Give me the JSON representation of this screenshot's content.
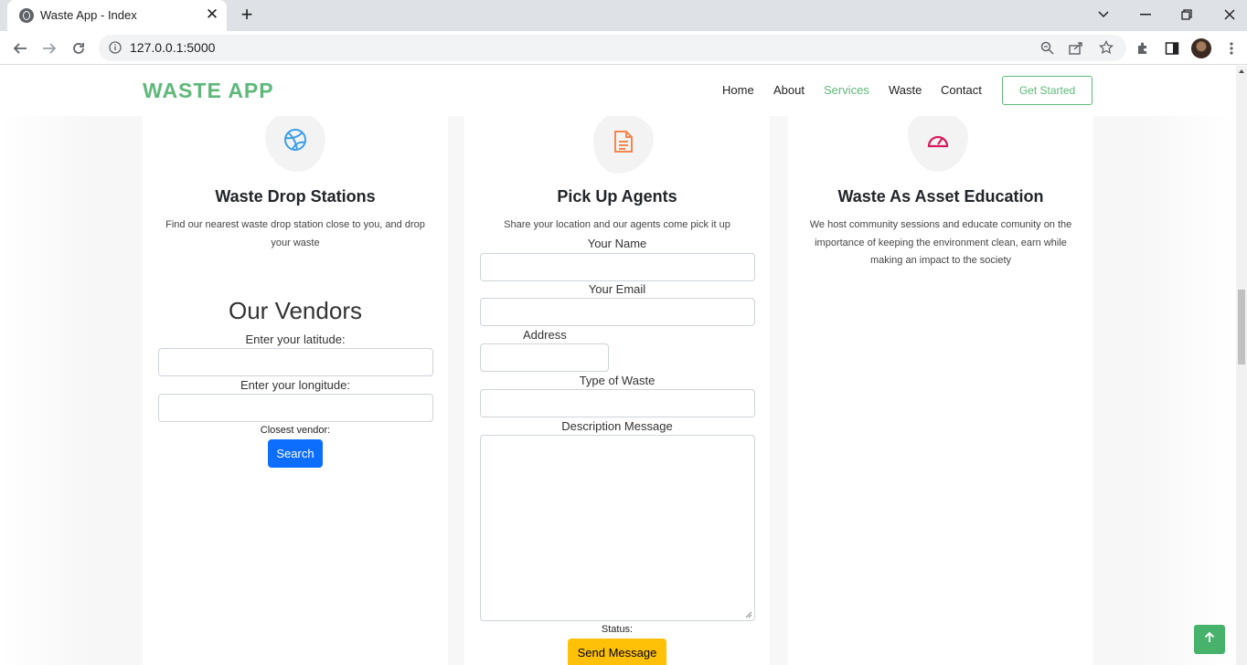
{
  "browser": {
    "tab_title": "Waste App - Index",
    "url": "127.0.0.1:5000"
  },
  "site": {
    "logo": "WASTE APP",
    "nav": [
      {
        "label": "Home",
        "active": false
      },
      {
        "label": "About",
        "active": false
      },
      {
        "label": "Services",
        "active": true
      },
      {
        "label": "Waste",
        "active": false
      },
      {
        "label": "Contact",
        "active": false
      }
    ],
    "cta_label": "Get Started"
  },
  "cards": [
    {
      "icon": "dribbble-icon",
      "icon_color": "#3b9ee8",
      "title": "Waste Drop Stations",
      "text": "Find our nearest waste drop station close to you, and drop your waste"
    },
    {
      "icon": "document-icon",
      "icon_color": "#f5864e",
      "title": "Pick Up Agents",
      "text": "Share your location and our agents come pick it up"
    },
    {
      "icon": "speedometer-icon",
      "icon_color": "#d81b60",
      "title": "Waste As Asset Education",
      "text": "We host community sessions and educate comunity on the importance of keeping the environment clean, earn while making an impact to the society"
    }
  ],
  "vendors": {
    "title": "Our Vendors",
    "latitude_label": "Enter your latitude:",
    "longitude_label": "Enter your longitude:",
    "closest_label": "Closest vendor:",
    "search_label": "Search"
  },
  "pickup_form": {
    "name_label": "Your Name",
    "email_label": "Your Email",
    "address_label": "Address",
    "waste_type_label": "Type of Waste",
    "message_label": "Description Message",
    "status_label": "Status:",
    "submit_label": "Send Message"
  },
  "colors": {
    "brand_green": "#5fb87a",
    "primary_blue": "#0d6efd",
    "warning_yellow": "#ffc107"
  }
}
